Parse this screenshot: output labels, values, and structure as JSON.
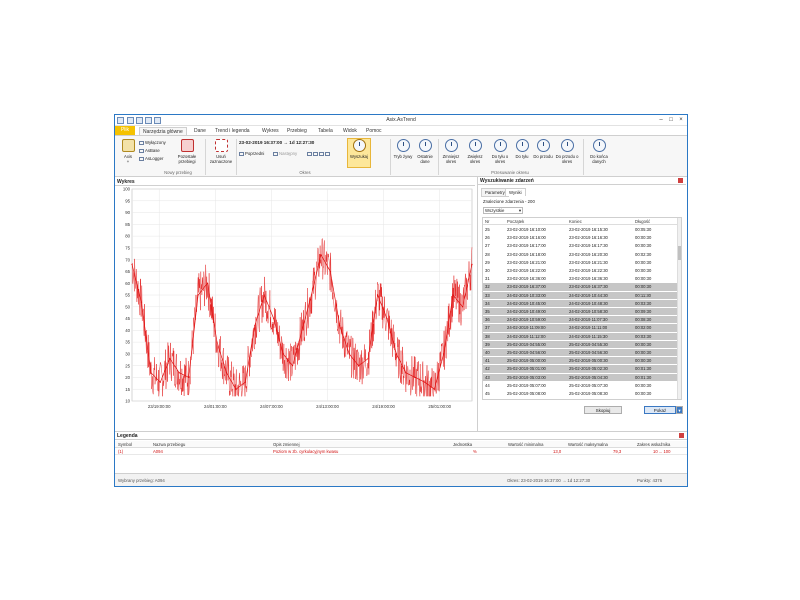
{
  "window": {
    "title": "Asix.AsTrend"
  },
  "tabs": [
    "Plik",
    "Narzędzia główne",
    "Dane",
    "Trend i legenda",
    "Wykres",
    "Przebieg",
    "Tabela",
    "Widok",
    "Pomoc"
  ],
  "ribbon": {
    "axis_label": "Axis",
    "axis_sub": "+",
    "wylaczony": "Wyłączony",
    "asbase": "AsBase",
    "aslogger": "AsLogger",
    "pozostale": "Pozostałe przebiegi",
    "usun": "Usuń zaznaczone",
    "group_nowy": "Nowy przebieg",
    "date_range": "23-02-2019  16:37:00 → 1d 12:27:30",
    "poprzedni": "Poprzedni",
    "nastepny": "Następny",
    "group_okres": "Okres",
    "wyszukaj": "Wyszukaj",
    "tryb": "Tryb żywy",
    "ostatnie": "Ostatnie dane",
    "zmniejsz": "Zmniejsz okres",
    "zwieksz": "Zwiększ okres",
    "do_tylu_o_okres": "Do tyłu o okres",
    "do_tylu": "Do tyłu",
    "do_przodu": "Do przodu",
    "do_przodu_o_okres": "Do przodu o okres",
    "do_konca": "Do końca danych",
    "group_przesuwanie": "Przesuwanie okresu"
  },
  "chart_panel": {
    "title": "Wykres"
  },
  "chart_data": {
    "type": "line",
    "title": "",
    "xlabel": "",
    "ylabel": "",
    "ylim": [
      10,
      100
    ],
    "yticks": [
      10,
      15,
      20,
      25,
      30,
      35,
      40,
      45,
      50,
      55,
      60,
      65,
      70,
      75,
      80,
      85,
      90,
      95,
      100
    ],
    "xtick_labels": [
      "23/19:00:00",
      "24/01:00:00",
      "24/07:00:00",
      "24/13:00:00",
      "24/19:00:00",
      "25/01:00:00"
    ],
    "series": [
      {
        "name": "A094",
        "color": "#e01010",
        "x_hours": [
          0,
          1,
          2,
          3,
          4,
          5,
          6,
          7,
          8,
          9,
          10,
          11,
          12,
          13,
          14,
          15,
          16,
          17,
          18,
          19,
          20,
          21,
          22,
          23,
          24,
          25,
          26,
          27,
          28,
          29,
          30,
          31,
          32,
          33,
          34,
          35,
          36
        ],
        "values": [
          68,
          52,
          22,
          18,
          28,
          22,
          20,
          55,
          60,
          35,
          22,
          15,
          18,
          42,
          55,
          45,
          30,
          25,
          40,
          55,
          72,
          65,
          42,
          30,
          25,
          28,
          55,
          45,
          30,
          22,
          20,
          18,
          15,
          30,
          55,
          50,
          68
        ]
      }
    ]
  },
  "search_panel": {
    "title": "Wyszukiwanie zdarzeń",
    "tab_params": "Parametry",
    "tab_results": "Wyniki",
    "found": "Znalezione zdarzenia - 200",
    "filter": "Wszystkie",
    "headers": [
      "Nr",
      "Początek",
      "Koniec",
      "Długość"
    ],
    "rows": [
      [
        "25",
        "23-02-2019 16:10:00",
        "23-02-2019 16:15:30",
        "00:05:30"
      ],
      [
        "26",
        "23-02-2019 16:16:00",
        "23-02-2019 16:16:30",
        "00:00:30"
      ],
      [
        "27",
        "23-02-2019 16:17:00",
        "23-02-2019 16:17:30",
        "00:00:30"
      ],
      [
        "28",
        "23-02-2019 16:18:00",
        "23-02-2019 16:20:30",
        "00:02:30"
      ],
      [
        "29",
        "23-02-2019 16:21:00",
        "23-02-2019 16:21:30",
        "00:00:30"
      ],
      [
        "30",
        "23-02-2019 16:22:00",
        "23-02-2019 16:22:30",
        "00:00:30"
      ],
      [
        "31",
        "23-02-2019 16:36:00",
        "23-02-2019 16:36:30",
        "00:00:30"
      ],
      [
        "32",
        "23-02-2019 16:37:00",
        "23-02-2019 16:37:30",
        "00:00:30"
      ],
      [
        "33",
        "24-02-2019 10:33:00",
        "24-02-2019 10:44:30",
        "00:11:30"
      ],
      [
        "34",
        "24-02-2019 10:45:00",
        "24-02-2019 10:48:30",
        "00:03:30"
      ],
      [
        "35",
        "24-02-2019 10:49:00",
        "24-02-2019 10:58:30",
        "00:09:30"
      ],
      [
        "36",
        "24-02-2019 10:59:00",
        "24-02-2019 11:07:30",
        "00:08:30"
      ],
      [
        "37",
        "24-02-2019 11:09:00",
        "24-02-2019 11:11:00",
        "00:02:00"
      ],
      [
        "38",
        "24-02-2019 11:12:00",
        "24-02-2019 11:15:30",
        "00:03:30"
      ],
      [
        "39",
        "25-02-2019 04:55:00",
        "25-02-2019 04:55:30",
        "00:00:30"
      ],
      [
        "40",
        "25-02-2019 04:56:00",
        "25-02-2019 04:56:30",
        "00:00:30"
      ],
      [
        "41",
        "25-02-2019 05:00:00",
        "25-02-2019 05:00:30",
        "00:00:30"
      ],
      [
        "42",
        "25-02-2019 05:01:00",
        "25-02-2019 05:02:30",
        "00:01:30"
      ],
      [
        "43",
        "25-02-2019 05:03:00",
        "25-02-2019 05:04:30",
        "00:01:30"
      ],
      [
        "44",
        "25-02-2019 05:07:00",
        "25-02-2019 05:07:30",
        "00:00:30"
      ],
      [
        "45",
        "25-02-2019 05:08:00",
        "25-02-2019 05:08:30",
        "00:00:30"
      ]
    ],
    "btn_skopiuj": "Skopiuj",
    "btn_pokaz": "Pokaż"
  },
  "legend_panel": {
    "title": "Legenda",
    "headers": [
      "Symbol",
      "Nazwa przebiegu",
      "Opis zmiennej",
      "Jednostka",
      "Wartość minimalna",
      "Wartość maksymalna",
      "Zakres wskaźnika"
    ],
    "row": [
      "(1)",
      "A094",
      "Poziom w zb. cyrkulacyjnym kwasu",
      "%",
      "13,0",
      "79,3",
      "10 ... 100"
    ]
  },
  "status": {
    "left": "Wybrany przebieg: A094",
    "middle": "Okres: 23-02-2019  16:37:00 → 1d 12:27:30",
    "right": "Punkty: 4376"
  }
}
